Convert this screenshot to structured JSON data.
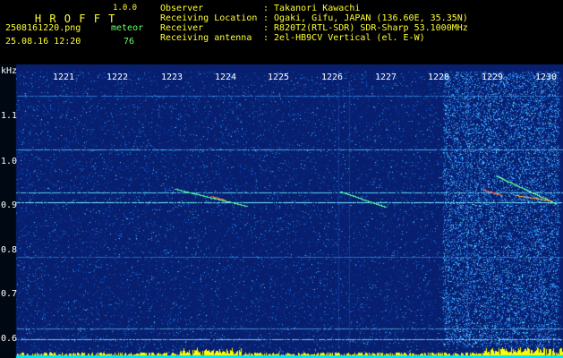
{
  "app": {
    "name": "H R O F F T",
    "version": "1.0.0"
  },
  "file": {
    "filename": "2508161220.png",
    "datetime": "25.08.16 12:20",
    "meteor_label": "meteor",
    "meteor_count": "76"
  },
  "info": [
    {
      "key": "Observer",
      "value": ": Takanori Kawachi"
    },
    {
      "key": "Receiving Location",
      "value": ": Ogaki, Gifu, JAPAN (136.60E, 35.35N)"
    },
    {
      "key": "Receiver",
      "value": ": R820T2(RTL-SDR) SDR-Sharp 53.1000MHz"
    },
    {
      "key": "Receiving antenna",
      "value": ": 2el-HB9CV Vertical (el. E-W)"
    }
  ],
  "axis": {
    "unit": "kHz",
    "time_ticks": [
      "1221",
      "1222",
      "1223",
      "1224",
      "1225",
      "1226",
      "1227",
      "1228",
      "1229",
      "1230"
    ],
    "freq_ticks": [
      "1.1",
      "1.0",
      "0.9",
      "0.8",
      "0.7",
      "0.6"
    ]
  },
  "colors": {
    "header_text": "#ffff33",
    "meteor_text": "#66ff66",
    "background_noise": "#0a2a8a",
    "signal": "#00ffff",
    "burst": "#ffff00"
  }
}
